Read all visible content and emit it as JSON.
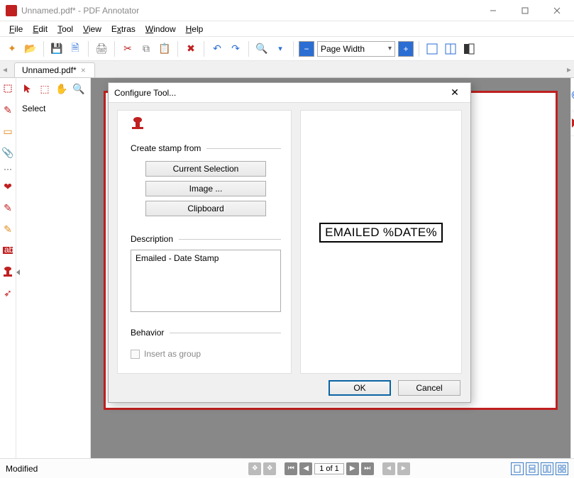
{
  "window": {
    "title": "Unnamed.pdf* - PDF Annotator"
  },
  "menu": {
    "items": [
      "File",
      "Edit",
      "Tool",
      "View",
      "Extras",
      "Window",
      "Help"
    ]
  },
  "toolbar": {
    "zoom_mode": "Page Width"
  },
  "tabs": {
    "active": "Unnamed.pdf*"
  },
  "second_col": {
    "mode_label": "Select"
  },
  "dialog": {
    "title": "Configure Tool...",
    "section_create": "Create stamp from",
    "btn_current_selection": "Current Selection",
    "btn_image": "Image ...",
    "btn_clipboard": "Clipboard",
    "section_description": "Description",
    "description_value": "Emailed - Date Stamp",
    "section_behavior": "Behavior",
    "chk_insert_group": "Insert as group",
    "preview_text": "EMAILED %DATE%",
    "ok": "OK",
    "cancel": "Cancel"
  },
  "status": {
    "left": "Modified",
    "page": "1 of 1"
  }
}
